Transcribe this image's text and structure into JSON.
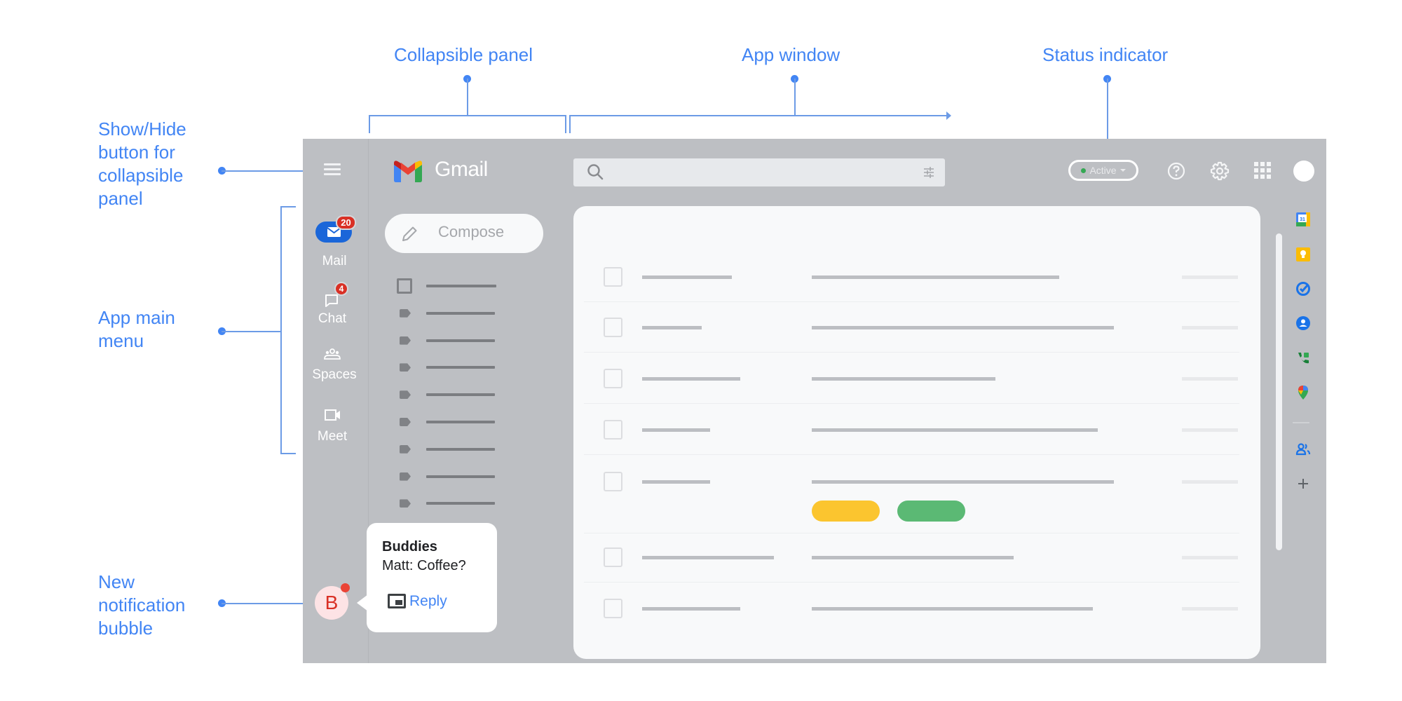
{
  "callouts": {
    "collapsible_panel": "Collapsible panel",
    "app_window": "App window",
    "status_indicator": "Status indicator",
    "show_hide": [
      "Show/Hide",
      "button for",
      "collapsible",
      "panel"
    ],
    "app_main_menu": [
      "App main",
      "menu"
    ],
    "new_notification": [
      "New",
      "notification",
      "bubble"
    ]
  },
  "header": {
    "app_name": "Gmail",
    "search_placeholder": "",
    "status": {
      "label": "Active",
      "dot_color": "#34a853"
    }
  },
  "rail": {
    "items": [
      {
        "label": "Mail",
        "icon": "mail-icon",
        "badge": "20",
        "selected": true
      },
      {
        "label": "Chat",
        "icon": "chat-icon",
        "badge": "4"
      },
      {
        "label": "Spaces",
        "icon": "spaces-icon"
      },
      {
        "label": "Meet",
        "icon": "video-icon"
      }
    ]
  },
  "nav": {
    "compose_label": "Compose",
    "items": [
      "inbox-icon",
      "label-icon",
      "label-icon",
      "label-icon",
      "label-icon",
      "label-icon",
      "label-icon",
      "label-icon",
      "label-icon"
    ]
  },
  "notification": {
    "avatar_letter": "B",
    "title": "Buddies",
    "message": "Matt: Coffee?",
    "action_label": "Reply"
  },
  "mail_list": {
    "rows": 7,
    "chips": [
      {
        "color": "#fbc52f"
      },
      {
        "color": "#5bb974"
      }
    ]
  },
  "side_panel": {
    "apps": [
      "calendar-icon",
      "keep-icon",
      "tasks-icon",
      "contacts-icon",
      "voice-icon",
      "maps-icon"
    ],
    "extra": [
      "people-icon",
      "add-icon"
    ],
    "calendar_day": "31"
  },
  "colors": {
    "annotation": "#4285f4",
    "app_bg": "#bdbfc3",
    "badge": "#d93025"
  }
}
